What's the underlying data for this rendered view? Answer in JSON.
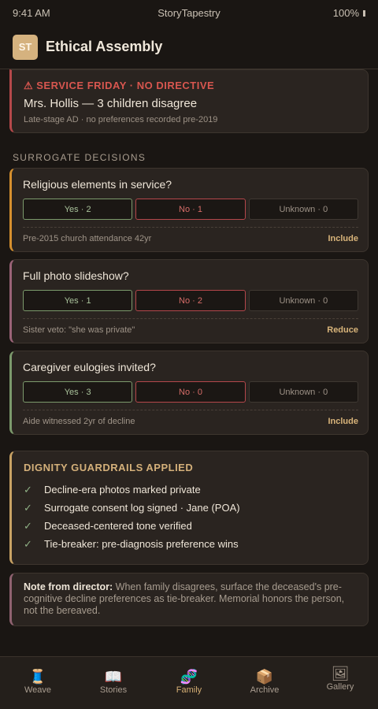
{
  "status": {
    "time": "9:41 AM",
    "carrier": "StoryTapestry",
    "battery": "100%"
  },
  "header": {
    "logo": "ST",
    "title": "Ethical Assembly"
  },
  "alert": {
    "title": "⚠ SERVICE FRIDAY · NO DIRECTIVE",
    "name": "Mrs. Hollis — 3 children disagree",
    "sub": "Late-stage AD · no preferences recorded pre-2019"
  },
  "section_label": "SURROGATE DECISIONS",
  "decisions": [
    {
      "question": "Religious elements in service?",
      "yes": "Yes · 2",
      "no": "No · 1",
      "unknown": "Unknown · 0",
      "note": "Pre-2015 church attendance 42yr",
      "rec": "Include",
      "accent": "#d6902e"
    },
    {
      "question": "Full photo slideshow?",
      "yes": "Yes · 1",
      "no": "No · 2",
      "unknown": "Unknown · 0",
      "note": "Sister veto: \"she was private\"",
      "rec": "Reduce",
      "accent": "#9a6377"
    },
    {
      "question": "Caregiver eulogies invited?",
      "yes": "Yes · 3",
      "no": "No · 0",
      "unknown": "Unknown · 0",
      "note": "Aide witnessed 2yr of decline",
      "rec": "Include",
      "accent": "#7c9a6c"
    }
  ],
  "guardrails": {
    "title": "DIGNITY GUARDRAILS APPLIED",
    "items": [
      "Decline-era photos marked private",
      "Surrogate consent log signed · Jane (POA)",
      "Deceased-centered tone verified",
      "Tie-breaker: pre-diagnosis preference wins"
    ]
  },
  "note": {
    "label": "Note from director:",
    "text": " When family disagrees, surface the deceased's pre-cognitive decline preferences as tie-breaker. Memorial honors the person, not the bereaved."
  },
  "tabs": [
    {
      "label": "Weave",
      "icon": "🧵",
      "icon_name": "thread-spool-icon"
    },
    {
      "label": "Stories",
      "icon": "📖",
      "icon_name": "open-book-icon"
    },
    {
      "label": "Family",
      "icon": "🧬",
      "icon_name": "family-icon"
    },
    {
      "label": "Archive",
      "icon": "📦",
      "icon_name": "archive-box-icon"
    },
    {
      "label": "Gallery",
      "icon": "🖼",
      "icon_name": "framed-picture-icon"
    }
  ],
  "active_tab": "Family",
  "colors": {
    "accent": "#d4ae74",
    "danger": "#d8564f",
    "success": "#8fb085",
    "background": "#1a1613"
  }
}
